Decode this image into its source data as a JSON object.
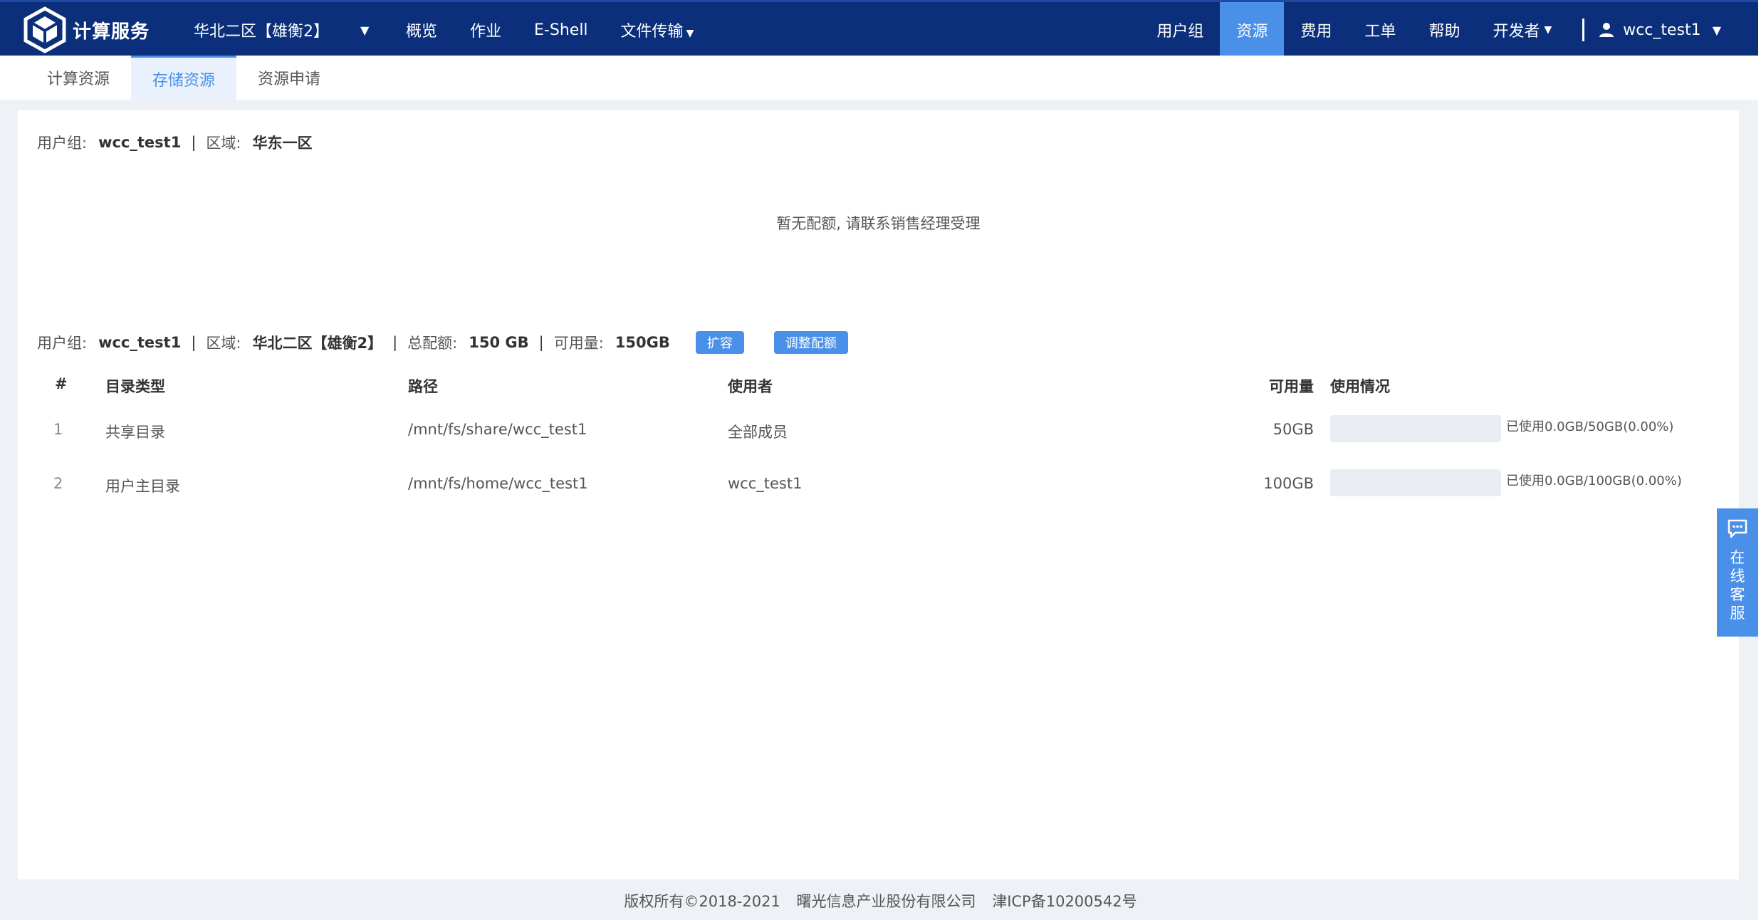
{
  "brand": {
    "name": "计算服务"
  },
  "region": {
    "label": "华北二区【雄衡2】"
  },
  "nav": {
    "overview": "概览",
    "jobs": "作业",
    "eshell": "E-Shell",
    "transfer": "文件传输",
    "usergroup": "用户组",
    "resource": "资源",
    "cost": "费用",
    "ticket": "工单",
    "help": "帮助",
    "developer": "开发者"
  },
  "user": {
    "name": "wcc_test1"
  },
  "tabs": [
    "计算资源",
    "存储资源",
    "资源申请"
  ],
  "section1": {
    "group_label": "用户组:",
    "group": "wcc_test1",
    "region_label": "区域:",
    "region": "华东一区",
    "empty": "暂无配额, 请联系销售经理受理"
  },
  "section2": {
    "group_label": "用户组:",
    "group": "wcc_test1",
    "region_label": "区域:",
    "region": "华北二区【雄衡2】",
    "quota_label": "总配额:",
    "quota": "150 GB",
    "available_label": "可用量:",
    "available": "150GB",
    "expand_btn": "扩容",
    "adjust_btn": "调整配额"
  },
  "table": {
    "headers": [
      "#",
      "目录类型",
      "路径",
      "使用者",
      "可用量",
      "使用情况"
    ],
    "rows": [
      {
        "no": "1",
        "type": "共享目录",
        "path": "/mnt/fs/share/wcc_test1",
        "user": "全部成员",
        "available": "50GB",
        "usage": "已使用0.0GB/50GB(0.00%)",
        "usage_percent": 0
      },
      {
        "no": "2",
        "type": "用户主目录",
        "path": "/mnt/fs/home/wcc_test1",
        "user": "wcc_test1",
        "available": "100GB",
        "usage": "已使用0.0GB/100GB(0.00%)",
        "usage_percent": 0
      }
    ]
  },
  "footer": {
    "copyright": "版权所有©2018-2021",
    "company": "曙光信息产业股份有限公司",
    "icp": "津ICP备10200542号"
  },
  "service": {
    "label": "在线客服"
  },
  "colors": {
    "topbar": "#0b2f7a",
    "accent": "#4a90e8"
  }
}
